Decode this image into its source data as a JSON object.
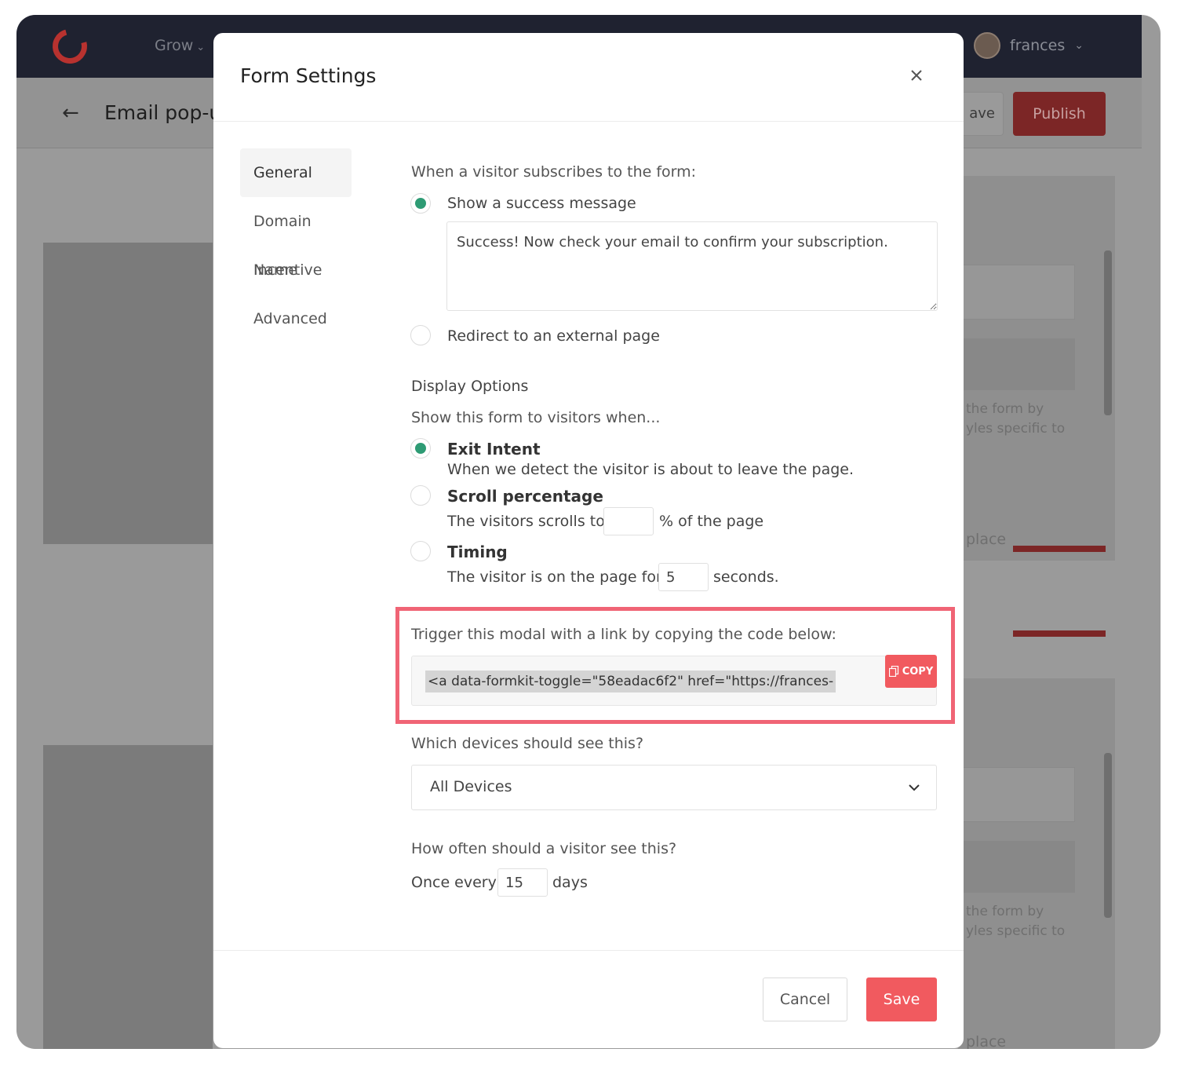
{
  "app": {
    "nav_grow": "Grow",
    "user_name": "frances",
    "page_title": "Email pop-u",
    "save_partial": "ave",
    "publish": "Publish",
    "bg_text_1a": "the form by",
    "bg_text_1b": "yles specific to",
    "bg_text_2a": "the form by",
    "bg_text_2b": "yles specific to",
    "bg_replace_1": "place",
    "bg_replace_2": "place"
  },
  "modal": {
    "title": "Form Settings",
    "nav": {
      "items": [
        {
          "label": "General",
          "active": true
        },
        {
          "label": "Domain Name"
        },
        {
          "label": "Incentive"
        },
        {
          "label": "Advanced"
        }
      ]
    },
    "subscribe": {
      "heading": "When a visitor subscribes to the form:",
      "option_success": "Show a success message",
      "success_message": "Success! Now check your email to confirm your subscription.",
      "option_redirect": "Redirect to an external page"
    },
    "display": {
      "heading": "Display Options",
      "subheading": "Show this form to visitors when...",
      "exit_intent": {
        "label": "Exit Intent",
        "description": "When we detect the visitor is about to leave the page.",
        "checked": true
      },
      "scroll": {
        "label": "Scroll percentage",
        "prefix": "The visitors scrolls to",
        "value": "",
        "suffix": "% of the page"
      },
      "timing": {
        "label": "Timing",
        "prefix": "The visitor is on the page for",
        "value": "5",
        "suffix": "seconds."
      }
    },
    "trigger": {
      "heading": "Trigger this modal with a link by copying the code below:",
      "code": "<a data-formkit-toggle=\"58eadac6f2\" href=\"https://frances-",
      "copy_label": "COPY"
    },
    "devices": {
      "heading": "Which devices should see this?",
      "selected": "All Devices"
    },
    "frequency": {
      "heading": "How often should a visitor see this?",
      "prefix": "Once every",
      "value": "15",
      "suffix": "days"
    },
    "footer": {
      "cancel": "Cancel",
      "save": "Save"
    }
  },
  "colors": {
    "accent": "#f15a5f",
    "radio_checked": "#2e9b74",
    "highlight_border": "#f06475"
  }
}
